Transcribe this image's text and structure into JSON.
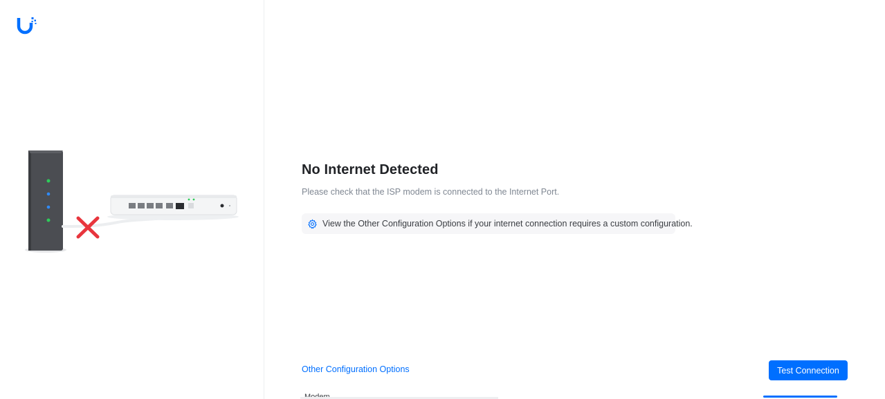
{
  "brand": {
    "logo_icon": "ubiquiti-logo-icon",
    "accent_color": "#006fff"
  },
  "illustration": {
    "icons": [
      "modem-icon",
      "gateway-device-icon",
      "disconnected-x-icon",
      "ethernet-cable-icon"
    ],
    "error_color": "#e8353d"
  },
  "main": {
    "title": "No Internet Detected",
    "subtitle": "Please check that the ISP modem is connected to the Internet Port.",
    "info": {
      "icon": "gear-icon",
      "text": "View the Other Configuration Options if your internet connection requires a custom configuration."
    }
  },
  "footer": {
    "other_options_link": "Other Configuration Options",
    "test_connection_button": "Test Connection"
  },
  "underlay": {
    "partial_text": "Modem"
  }
}
